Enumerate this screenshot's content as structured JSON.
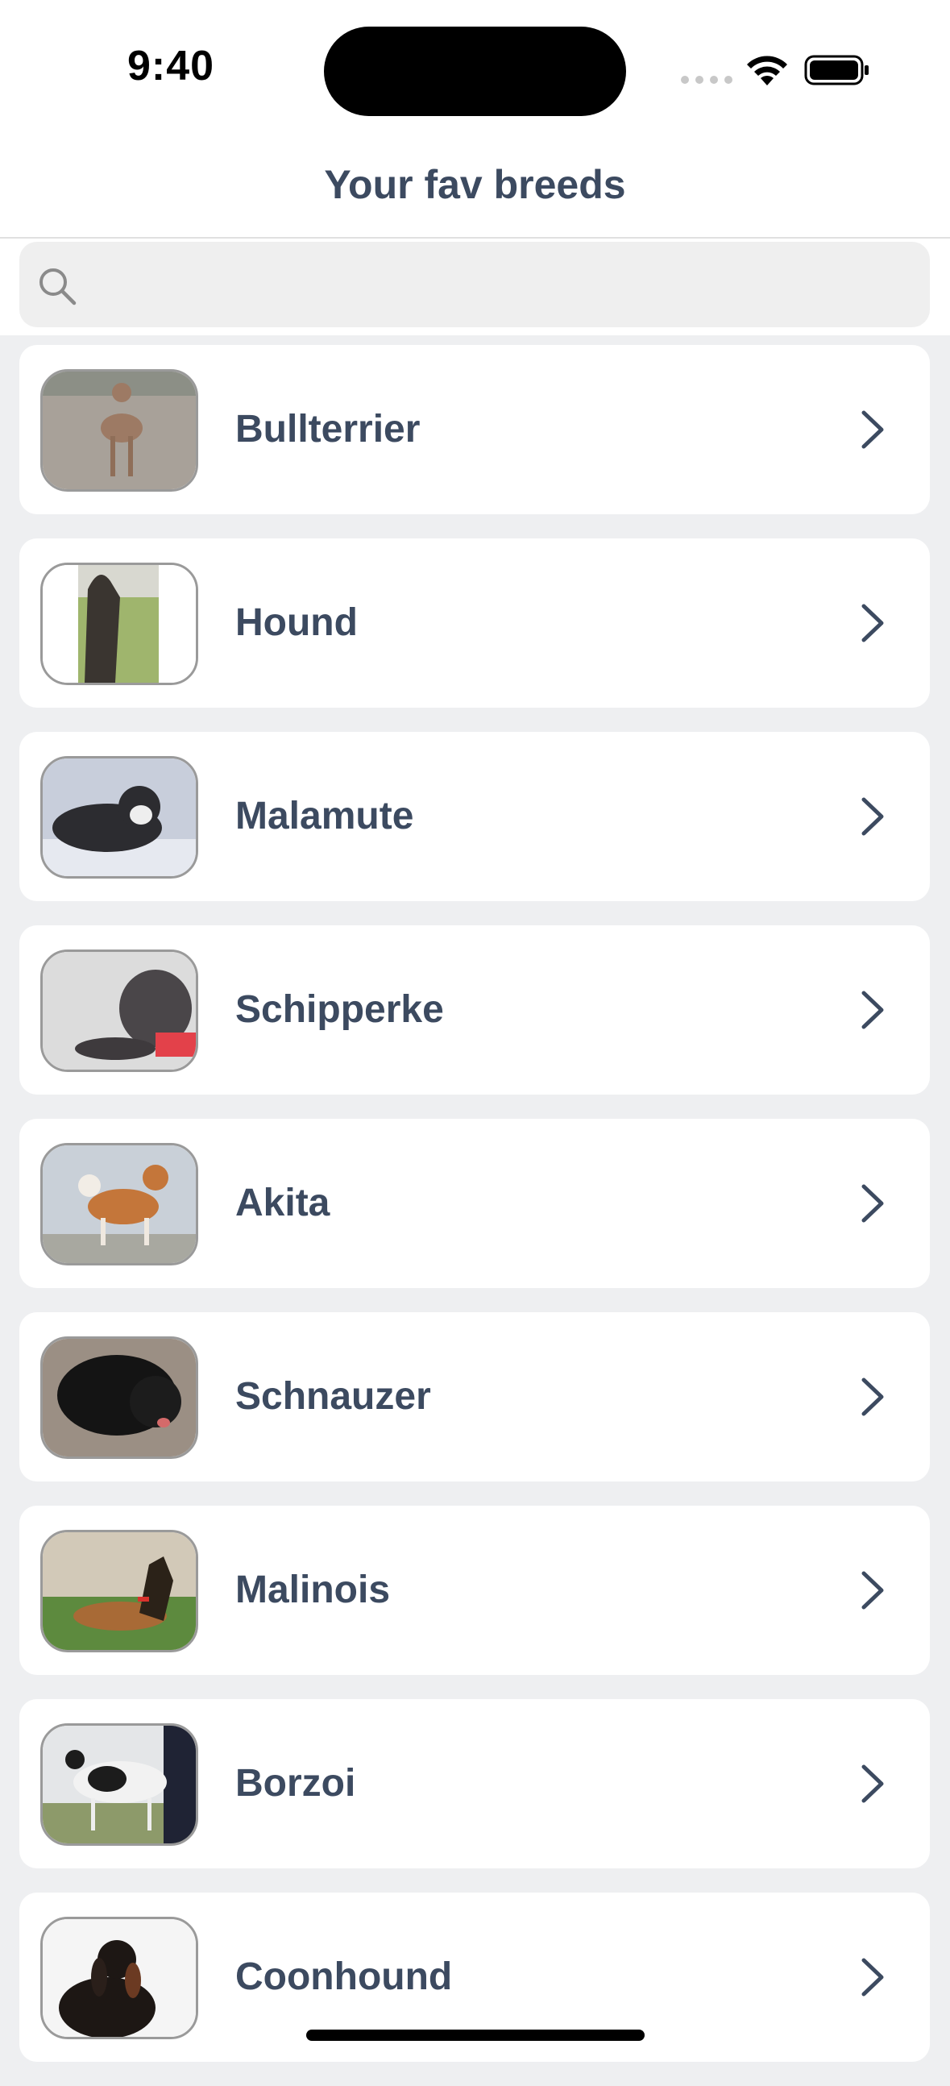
{
  "status_bar": {
    "time": "9:40"
  },
  "header": {
    "title": "Your fav breeds"
  },
  "search": {
    "placeholder": ""
  },
  "breeds": [
    {
      "name": "Bullterrier",
      "icon": "chevron-right-icon"
    },
    {
      "name": "Hound",
      "icon": "chevron-right-icon"
    },
    {
      "name": "Malamute",
      "icon": "chevron-right-icon"
    },
    {
      "name": "Schipperke",
      "icon": "chevron-right-icon"
    },
    {
      "name": "Akita",
      "icon": "chevron-right-icon"
    },
    {
      "name": "Schnauzer",
      "icon": "chevron-right-icon"
    },
    {
      "name": "Malinois",
      "icon": "chevron-right-icon"
    },
    {
      "name": "Borzoi",
      "icon": "chevron-right-icon"
    },
    {
      "name": "Coonhound",
      "icon": "chevron-right-icon"
    }
  ],
  "colors": {
    "text": "#3c4a60",
    "background": "#eeeff1",
    "card": "#ffffff"
  }
}
